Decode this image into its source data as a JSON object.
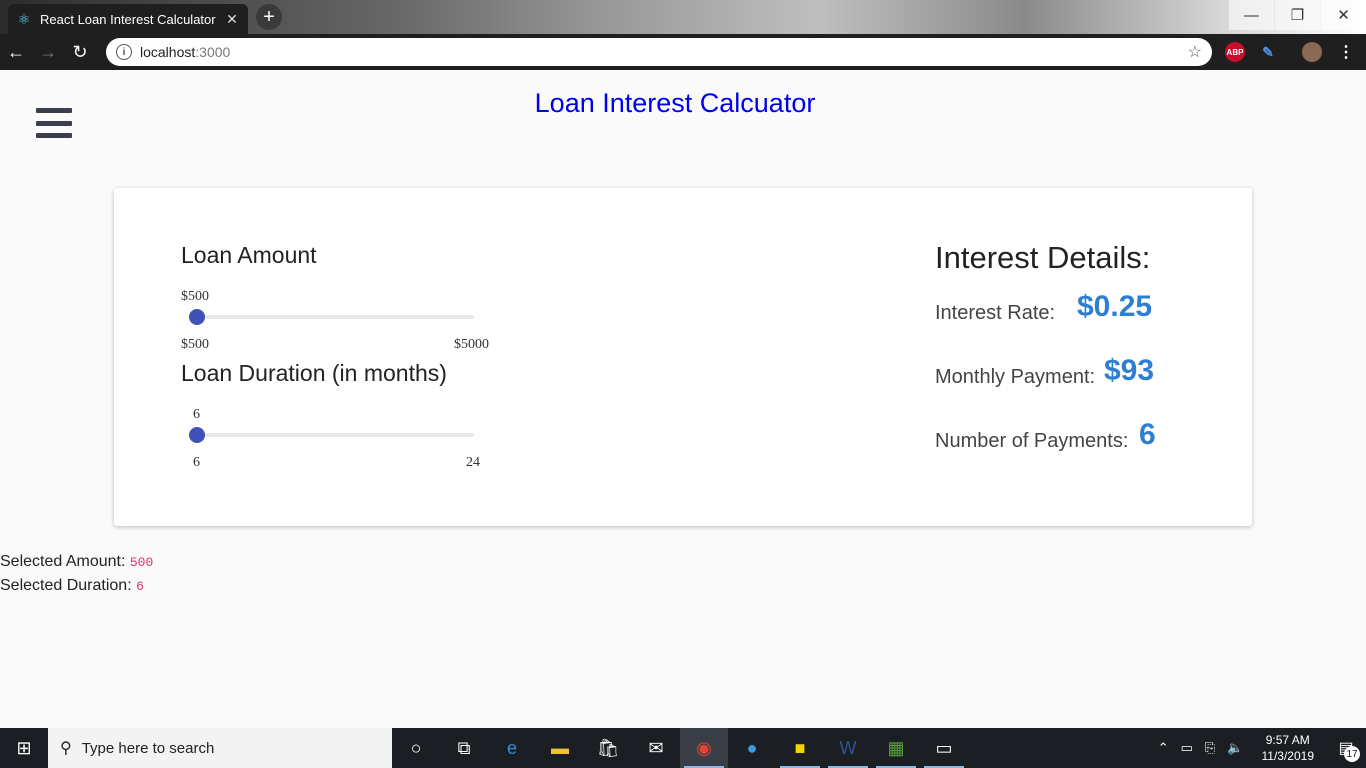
{
  "browser": {
    "tab_title": "React Loan Interest Calculator",
    "new_tab_icon": "+",
    "url_host": "localhost",
    "url_port": ":3000",
    "abp_label": "ABP"
  },
  "app": {
    "title": "Loan Interest Calcuator"
  },
  "loan_amount": {
    "label": "Loan Amount",
    "value_display": "$500",
    "min_label": "$500",
    "max_label": "$5000",
    "fraction": 0.0
  },
  "loan_duration": {
    "label": "Loan Duration (in months)",
    "value_display": "6",
    "min_label": "6",
    "max_label": "24",
    "fraction": 0.0
  },
  "details": {
    "title": "Interest Details:",
    "interest_rate_label": "Interest Rate:",
    "interest_rate_value": "$0.25",
    "monthly_payment_label": "Monthly Payment:",
    "monthly_payment_value": "$93",
    "num_payments_label": "Number of Payments:",
    "num_payments_value": "6"
  },
  "selected": {
    "amount_label": "Selected Amount:",
    "amount_value": "500",
    "duration_label": "Selected Duration:",
    "duration_value": "6"
  },
  "taskbar": {
    "search_placeholder": "Type here to search",
    "time": "9:57 AM",
    "date": "11/3/2019",
    "notification_count": "17"
  },
  "colors": {
    "title_link": "#0000ee",
    "accent_blue": "#2e7fd1",
    "slider_thumb": "#3f51b5",
    "code_pink": "#e0306a"
  }
}
